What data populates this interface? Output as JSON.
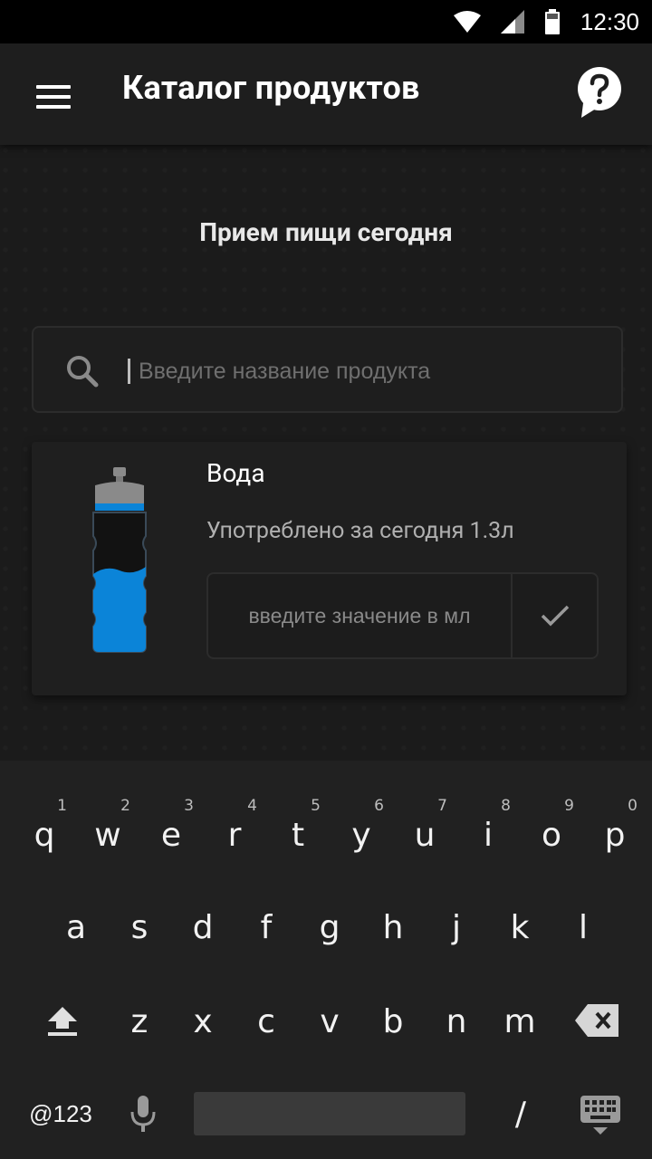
{
  "status_bar": {
    "time": "12:30"
  },
  "app_bar": {
    "title": "Каталог продуктов"
  },
  "section": {
    "title": "Прием пищи сегодня"
  },
  "search": {
    "placeholder": "Введите название продукта",
    "value": ""
  },
  "product": {
    "name": "Вода",
    "consumed_text": "Употреблено за сегодня 1.3л",
    "amount_placeholder": "введите значение в мл"
  },
  "keyboard": {
    "row1": [
      {
        "char": "q",
        "hint": "1"
      },
      {
        "char": "w",
        "hint": "2"
      },
      {
        "char": "e",
        "hint": "3"
      },
      {
        "char": "r",
        "hint": "4"
      },
      {
        "char": "t",
        "hint": "5"
      },
      {
        "char": "y",
        "hint": "6"
      },
      {
        "char": "u",
        "hint": "7"
      },
      {
        "char": "i",
        "hint": "8"
      },
      {
        "char": "o",
        "hint": "9"
      },
      {
        "char": "p",
        "hint": "0"
      }
    ],
    "row2": [
      "a",
      "s",
      "d",
      "f",
      "g",
      "h",
      "j",
      "k",
      "l"
    ],
    "row3": [
      "z",
      "x",
      "c",
      "v",
      "b",
      "n",
      "m"
    ],
    "symbols_label": "@123",
    "slash_label": "/"
  }
}
